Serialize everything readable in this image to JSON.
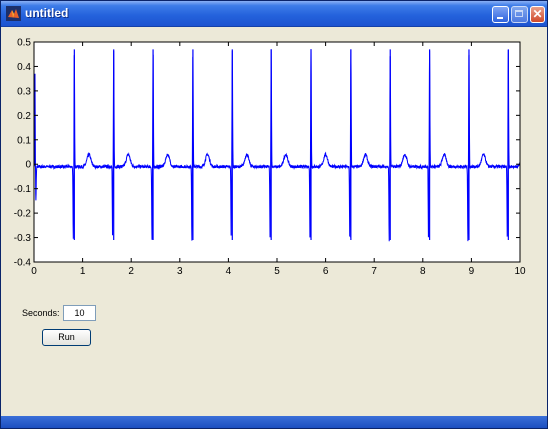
{
  "window": {
    "title": "untitled",
    "icon": "matlab-logo-icon",
    "controls": [
      "minimize-icon",
      "maximize-icon",
      "close-icon"
    ],
    "close_glyph": "✕"
  },
  "colors": {
    "titlebar": "#2462dc",
    "background": "#ece9d8",
    "plot_line": "#0000ff",
    "axes_bg": "#ffffff"
  },
  "controls": {
    "seconds_label": "Seconds:",
    "seconds_value": "10",
    "run_label": "Run"
  },
  "chart_data": {
    "type": "line",
    "title": "",
    "xlabel": "",
    "ylabel": "",
    "xlim": [
      0,
      10
    ],
    "ylim": [
      -0.4,
      0.5
    ],
    "x_ticks": [
      "0",
      "1",
      "2",
      "3",
      "4",
      "5",
      "6",
      "7",
      "8",
      "9",
      "10"
    ],
    "y_ticks": [
      "0.5",
      "0.4",
      "0.3",
      "0.2",
      "0.1",
      "0",
      "-0.1",
      "-0.2",
      "-0.3",
      "-0.4"
    ],
    "grid": false,
    "series": [
      {
        "color": "#0000ff",
        "r_peak_times": [
          0.83,
          1.64,
          2.45,
          3.27,
          4.08,
          4.88,
          5.7,
          6.52,
          7.33,
          8.14,
          8.95,
          9.76
        ],
        "r_peak_value": 0.47,
        "s_trough_value": -0.31,
        "t_wave_value": 0.04,
        "baseline_value": -0.01
      }
    ]
  }
}
